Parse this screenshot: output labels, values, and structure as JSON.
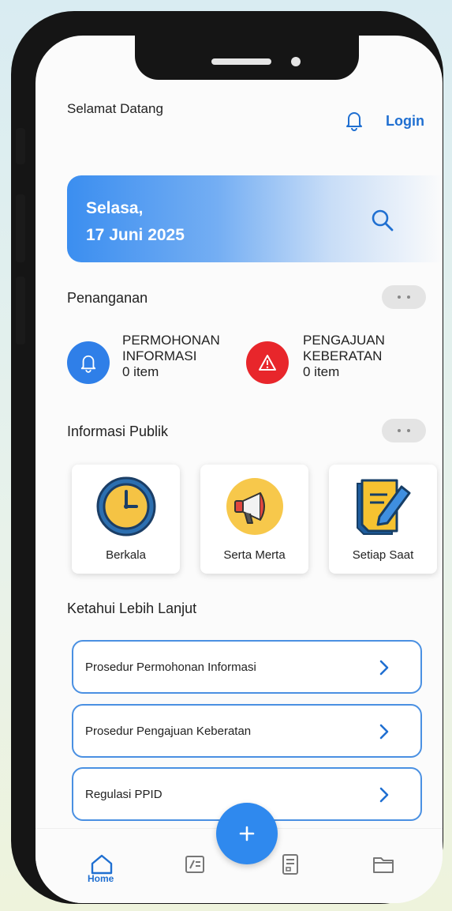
{
  "header": {
    "greeting": "Selamat Datang",
    "login_label": "Login"
  },
  "date_card": {
    "day": "Selasa,",
    "date": "17 Juni 2025"
  },
  "penanganan": {
    "title": "Penanganan",
    "items": [
      {
        "line1": "PERMOHONAN",
        "line2": "INFORMASI",
        "count": "0 item",
        "color": "#2f7fe8",
        "icon": "bell-icon"
      },
      {
        "line1": "PENGAJUAN",
        "line2": "KEBERATAN",
        "count": "0 item",
        "color": "#e8262b",
        "icon": "warning-icon"
      }
    ]
  },
  "informasi_publik": {
    "title": "Informasi Publik",
    "cards": [
      {
        "label": "Berkala",
        "icon": "clock-icon"
      },
      {
        "label": "Serta Merta",
        "icon": "megaphone-icon"
      },
      {
        "label": "Setiap Saat",
        "icon": "document-edit-icon"
      }
    ]
  },
  "lanjut": {
    "title": "Ketahui Lebih Lanjut",
    "links": [
      {
        "label": "Prosedur Permohonan Informasi"
      },
      {
        "label": "Prosedur Pengajuan Keberatan"
      },
      {
        "label": "Regulasi PPID"
      }
    ]
  },
  "nav": {
    "home_label": "Home",
    "items": [
      "home-icon",
      "edit-note-icon",
      "add-icon",
      "receipt-icon",
      "folder-icon"
    ]
  },
  "colors": {
    "accent": "#1f6fd1",
    "fab": "#2f89ee",
    "border": "#4a90e2"
  }
}
